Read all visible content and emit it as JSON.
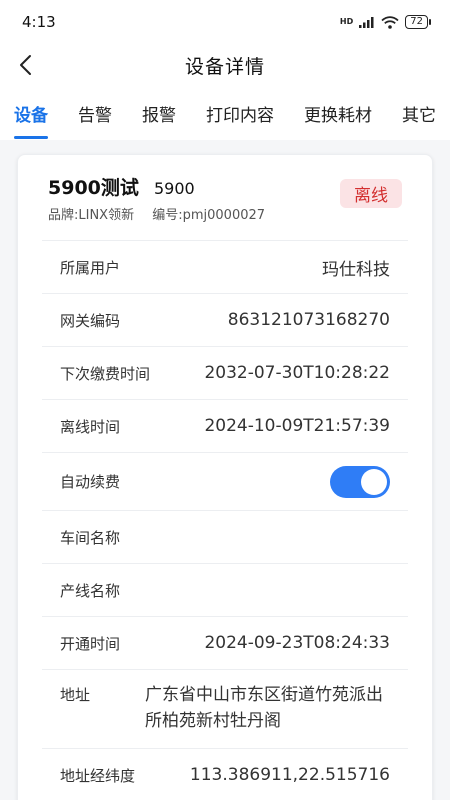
{
  "status_bar": {
    "time": "4:13",
    "signal_label": "HD",
    "battery": "72"
  },
  "nav": {
    "title": "设备详情"
  },
  "tabs": [
    {
      "label": "设备",
      "active": true
    },
    {
      "label": "告警",
      "active": false
    },
    {
      "label": "报警",
      "active": false
    },
    {
      "label": "打印内容",
      "active": false
    },
    {
      "label": "更换耗材",
      "active": false
    },
    {
      "label": "其它",
      "active": false
    }
  ],
  "device": {
    "name": "5900测试",
    "model": "5900",
    "brand": "品牌:LINX领新",
    "serial": "编号:pmj0000027",
    "status": "离线"
  },
  "rows": {
    "user": {
      "label": "所属用户",
      "value": "玛仕科技"
    },
    "gateway": {
      "label": "网关编码",
      "value": "863121073168270"
    },
    "next_fee": {
      "label": "下次缴费时间",
      "value": "2032-07-30T10:28:22"
    },
    "offline_time": {
      "label": "离线时间",
      "value": "2024-10-09T21:57:39"
    },
    "auto_renew": {
      "label": "自动续费",
      "on": true
    },
    "workshop": {
      "label": "车间名称",
      "value": ""
    },
    "line": {
      "label": "产线名称",
      "value": ""
    },
    "open_time": {
      "label": "开通时间",
      "value": "2024-09-23T08:24:33"
    },
    "address": {
      "label": "地址",
      "value": "广东省中山市东区街道竹苑派出所柏苑新村牡丹阁"
    },
    "coords": {
      "label": "地址经纬度",
      "value": "113.386911,22.515716"
    }
  },
  "colors": {
    "accent": "#1a73e8",
    "toggle_on": "#2f7df6",
    "offline_badge_bg": "#fbe3e5",
    "offline_badge_text": "#d32f2f"
  }
}
